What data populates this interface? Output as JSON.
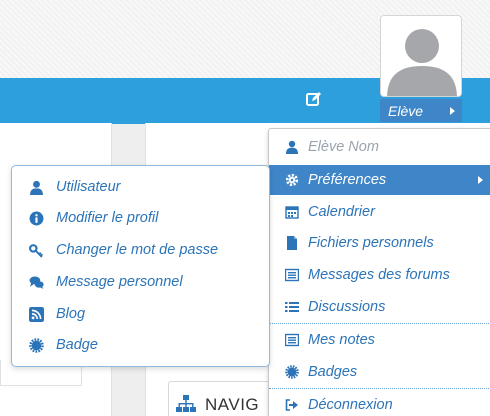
{
  "header": {
    "edit_icon": "edit-icon",
    "user_button_label": "Elève",
    "avatar_icon": "user-silhouette-icon"
  },
  "user_menu": {
    "items": [
      {
        "label": "Elève Nom",
        "icon": "user-icon",
        "state": "disabled"
      },
      {
        "label": "Préférences",
        "icon": "gear-icon",
        "state": "active"
      },
      {
        "label": "Calendrier",
        "icon": "calendar-icon"
      },
      {
        "label": "Fichiers personnels",
        "icon": "file-icon"
      },
      {
        "label": "Messages des forums",
        "icon": "list-icon"
      },
      {
        "label": "Discussions",
        "icon": "list-lines-icon"
      },
      {
        "label": "Mes notes",
        "icon": "list-icon"
      },
      {
        "label": "Badges",
        "icon": "certificate-icon"
      },
      {
        "label": "Déconnexion",
        "icon": "sign-out-icon"
      }
    ]
  },
  "preferences_submenu": {
    "items": [
      {
        "label": "Utilisateur",
        "icon": "user-icon"
      },
      {
        "label": "Modifier le profil",
        "icon": "info-circle-icon"
      },
      {
        "label": "Changer le mot de passe",
        "icon": "key-icon"
      },
      {
        "label": "Message personnel",
        "icon": "comments-icon"
      },
      {
        "label": "Blog",
        "icon": "rss-icon"
      },
      {
        "label": "Badge",
        "icon": "certificate-icon"
      }
    ]
  },
  "navigation_block": {
    "label": "NAVIG",
    "icon": "sitemap-icon"
  },
  "colors": {
    "navbar": "#2c9fdc",
    "active_item": "#3f86c8",
    "link": "#2c74b8",
    "disabled": "#9aa4ad"
  }
}
